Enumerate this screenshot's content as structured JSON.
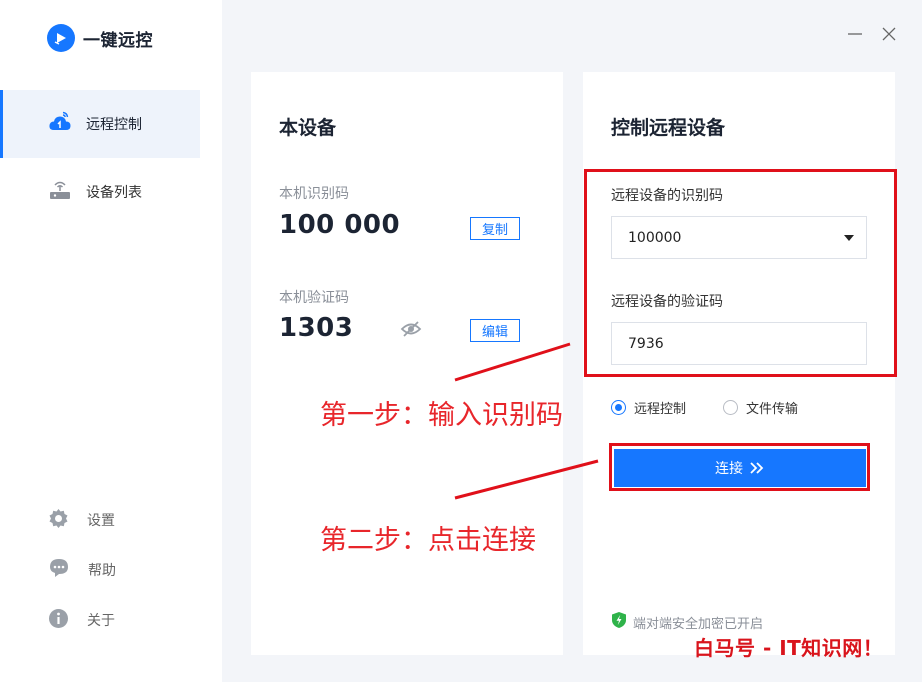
{
  "app": {
    "name": "一键远控"
  },
  "sidebar": {
    "items": [
      {
        "label": "远程控制",
        "active": true,
        "icon": "cloud-remote-icon"
      },
      {
        "label": "设备列表",
        "active": false,
        "icon": "device-list-icon"
      }
    ],
    "footer": [
      {
        "label": "设置",
        "icon": "gear-icon"
      },
      {
        "label": "帮助",
        "icon": "help-chat-icon"
      },
      {
        "label": "关于",
        "icon": "info-icon"
      }
    ]
  },
  "local": {
    "title": "本设备",
    "id_label": "本机识别码",
    "id_value": "100 000",
    "copy_label": "复制",
    "code_label": "本机验证码",
    "code_value": "1303",
    "edit_label": "编辑"
  },
  "remote": {
    "title": "控制远程设备",
    "id_label": "远程设备的识别码",
    "id_value": "100000",
    "code_label": "远程设备的验证码",
    "code_value": "7936",
    "mode_options": [
      {
        "label": "远程控制",
        "selected": true
      },
      {
        "label": "文件传输",
        "selected": false
      }
    ],
    "connect_label": "连接",
    "secure_text": "端对端安全加密已开启"
  },
  "annotations": {
    "step1": "第一步：输入识别码",
    "step2": "第二步：点击连接"
  },
  "watermark": "白马号 - IT知识网！",
  "colors": {
    "accent": "#1677ff",
    "annotation": "#e0101a",
    "secure": "#2fb34a"
  }
}
